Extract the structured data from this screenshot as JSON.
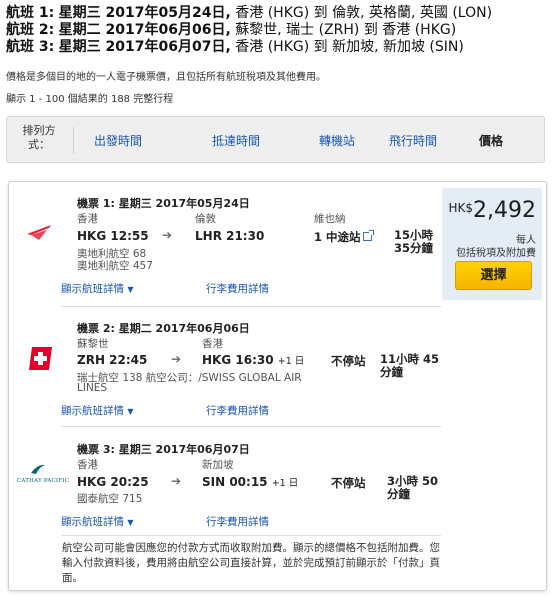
{
  "itinerary": [
    {
      "label": "航班 1:",
      "date": "星期三 2017年05月24日,",
      "route": "香港 (HKG) 到 倫敦, 英格蘭, 英國 (LON)"
    },
    {
      "label": "航班 2:",
      "date": "星期二 2017年06月06日,",
      "route": "蘇黎世, 瑞士 (ZRH) 到 香港 (HKG)"
    },
    {
      "label": "航班 3:",
      "date": "星期三 2017年06月07日,",
      "route": "香港 (HKG) 到 新加坡, 新加坡 (SIN)"
    }
  ],
  "notes": {
    "price_note": "價格是多個目的地的一人電子機票價，且包括所有航班稅項及其他費用。",
    "results_count": "顯示 1 - 100 個結果的 188 完整行程"
  },
  "sortbar": {
    "label": "排列方式：",
    "options": [
      "出發時間",
      "抵達時間",
      "轉機站",
      "飛行時間"
    ],
    "active": "價格"
  },
  "price": {
    "currency": "HK$",
    "amount": "2,492",
    "per_person": "每人",
    "includes": "包括稅項及附加費",
    "select_label": "選擇"
  },
  "legs": [
    {
      "title": "機票 1:  星期三 2017年05月24日",
      "origin_city": "香港",
      "dest_city": "倫敦",
      "via_label": "維也納",
      "dep": "HKG  12:55",
      "arr": "LHR  21:30",
      "arr_dayplus": "",
      "stops": "1 中途站",
      "duration": "15小時 35分鐘",
      "carrier_lines": [
        "奧地利航空 68",
        "奧地利航空 457"
      ],
      "airline_logo": "austrian-logo",
      "details_link": "顯示航班詳情",
      "baggage_link": "行李費用詳情"
    },
    {
      "title": "機票 2:  星期二 2017年06月06日",
      "origin_city": "蘇黎世",
      "dest_city": "香港",
      "dep": "ZRH  22:45",
      "arr": "HKG  16:30",
      "arr_dayplus": "+1 日",
      "stops": "不停站",
      "duration": "11小時 45分鐘",
      "carrier_lines": [
        "瑞士航空 138 航空公司：/SWISS GLOBAL AIR",
        "LINES"
      ],
      "airline_logo": "swiss-logo",
      "details_link": "顯示航班詳情",
      "baggage_link": "行李費用詳情"
    },
    {
      "title": "機票 3:  星期三 2017年06月07日",
      "origin_city": "香港",
      "dest_city": "新加坡",
      "dep": "HKG  20:25",
      "arr": "SIN  00:15",
      "arr_dayplus": "+1 日",
      "stops": "不停站",
      "duration": "3小時 50分鐘",
      "carrier_lines": [
        "國泰航空 715"
      ],
      "airline_logo": "cathay-pacific-logo",
      "airline_logo_text": "CATHAY PACIFIC",
      "details_link": "顯示航班詳情",
      "baggage_link": "行李費用詳情"
    }
  ],
  "fineprint": "航空公司可能會因應您的付款方式而收取附加費。顯示的總價格不包括附加費。您輸入付款資料後，費用將由航空公司直接計算，並於完成預訂前顯示於「付款」頁面。",
  "colors": {
    "link": "#1a56b8",
    "price_panel": "#e4ecf6",
    "select_button": "#f5b400",
    "swiss_red": "#e4002b",
    "cathay_green": "#006564",
    "austrian_red": "#e3263b"
  }
}
